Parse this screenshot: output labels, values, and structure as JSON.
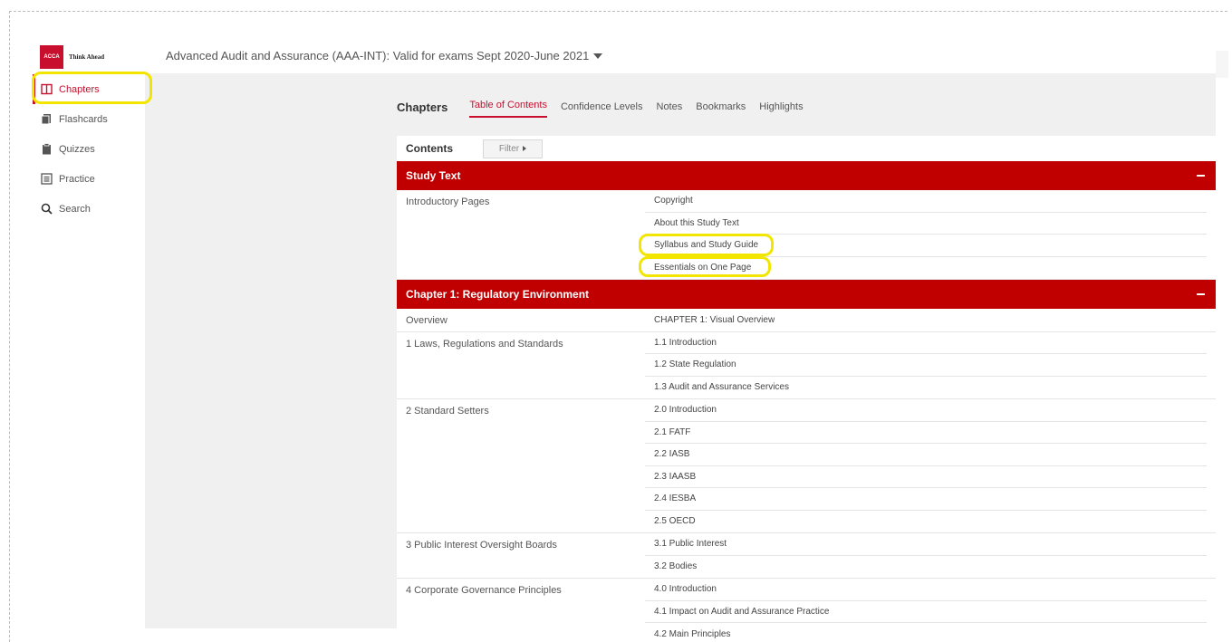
{
  "brand": {
    "logo_mark": "ACCA",
    "tagline": "Think Ahead",
    "color": "#c8102e"
  },
  "sidebar": {
    "items": [
      {
        "label": "Chapters",
        "icon": "book-icon",
        "active": true
      },
      {
        "label": "Flashcards",
        "icon": "flashcards-icon",
        "active": false
      },
      {
        "label": "Quizzes",
        "icon": "clipboard-icon",
        "active": false
      },
      {
        "label": "Practice",
        "icon": "practice-icon",
        "active": false
      },
      {
        "label": "Search",
        "icon": "search-icon",
        "active": false
      }
    ]
  },
  "course": {
    "title": "Advanced Audit and Assurance (AAA-INT): Valid for exams Sept 2020-June 2021"
  },
  "tabs": {
    "heading": "Chapters",
    "items": [
      "Table of Contents",
      "Confidence Levels",
      "Notes",
      "Bookmarks",
      "Highlights"
    ],
    "active": "Table of Contents"
  },
  "contents": {
    "label": "Contents",
    "filter_label": "Filter"
  },
  "sections": [
    {
      "title": "Study Text",
      "groups": [
        {
          "label": "Introductory Pages",
          "items": [
            "Copyright",
            "About this Study Text",
            "Syllabus and Study Guide",
            "Essentials on One Page"
          ]
        }
      ]
    },
    {
      "title": "Chapter 1: Regulatory Environment",
      "groups": [
        {
          "label": "Overview",
          "items": [
            "CHAPTER 1: Visual Overview"
          ]
        },
        {
          "label": "1 Laws, Regulations and Standards",
          "items": [
            "1.1 Introduction",
            "1.2 State Regulation",
            "1.3 Audit and Assurance Services"
          ]
        },
        {
          "label": "2 Standard Setters",
          "items": [
            "2.0 Introduction",
            "2.1 FATF",
            "2.2 IASB",
            "2.3 IAASB",
            "2.4 IESBA",
            "2.5 OECD"
          ]
        },
        {
          "label": "3 Public Interest Oversight Boards",
          "items": [
            "3.1 Public Interest",
            "3.2 Bodies"
          ]
        },
        {
          "label": "4 Corporate Governance Principles",
          "items": [
            "4.0 Introduction",
            "4.1 Impact on Audit and Assurance Practice",
            "4.2 Main Principles"
          ]
        }
      ]
    }
  ],
  "colors": {
    "accent": "#c00000",
    "highlight": "#f2e600",
    "panel": "#f0f0f0"
  }
}
